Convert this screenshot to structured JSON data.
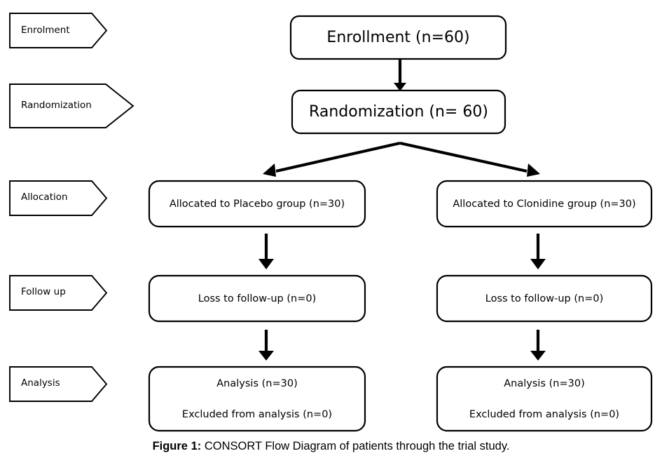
{
  "figure": {
    "caption_label": "Figure 1:",
    "caption_text": " CONSORT Flow Diagram of patients through the trial study."
  },
  "stage_labels": [
    {
      "id": "enrolment",
      "text": "Enrolment"
    },
    {
      "id": "randomization",
      "text": "Randomization"
    },
    {
      "id": "allocation",
      "text": "Allocation"
    },
    {
      "id": "follow-up",
      "text": "Follow up"
    },
    {
      "id": "analysis",
      "text": "Analysis"
    }
  ],
  "nodes": {
    "enrollment": {
      "line1": "Enrollment (n=60)"
    },
    "randomization": {
      "line1": "Randomization (n= 60)"
    },
    "allocation_left": {
      "line1": "Allocated to Placebo group (n=30)"
    },
    "allocation_right": {
      "line1": "Allocated to Clonidine group (n=30)"
    },
    "followup_left": {
      "line1": "Loss to follow-up (n=0)"
    },
    "followup_right": {
      "line1": "Loss to follow-up (n=0)"
    },
    "analysis_left": {
      "line1": "Analysis (n=30)",
      "line2": "Excluded from analysis (n=0)"
    },
    "analysis_right": {
      "line1": "Analysis (n=30)",
      "line2": "Excluded from analysis (n=0)"
    }
  },
  "colors": {
    "stroke": "#000000",
    "fill": "#ffffff",
    "text": "#000000"
  },
  "chart_data": {
    "type": "diagram",
    "title": "CONSORT Flow Diagram of patients through the trial study.",
    "stages": [
      "Enrolment",
      "Randomization",
      "Allocation",
      "Follow up",
      "Analysis"
    ],
    "nodes": [
      {
        "id": "enrollment",
        "stage": "Enrolment",
        "label": "Enrollment (n=60)",
        "n": 60
      },
      {
        "id": "randomization",
        "stage": "Randomization",
        "label": "Randomization (n= 60)",
        "n": 60
      },
      {
        "id": "allocation_left",
        "stage": "Allocation",
        "label": "Allocated to Placebo group (n=30)",
        "n": 30,
        "arm": "Placebo"
      },
      {
        "id": "allocation_right",
        "stage": "Allocation",
        "label": "Allocated to Clonidine group (n=30)",
        "n": 30,
        "arm": "Clonidine"
      },
      {
        "id": "followup_left",
        "stage": "Follow up",
        "label": "Loss to follow-up (n=0)",
        "n": 0,
        "arm": "Placebo"
      },
      {
        "id": "followup_right",
        "stage": "Follow up",
        "label": "Loss to follow-up (n=0)",
        "n": 0,
        "arm": "Clonidine"
      },
      {
        "id": "analysis_left",
        "stage": "Analysis",
        "label": "Analysis (n=30) / Excluded from analysis (n=0)",
        "n": 30,
        "excluded": 0,
        "arm": "Placebo"
      },
      {
        "id": "analysis_right",
        "stage": "Analysis",
        "label": "Analysis (n=30) / Excluded from analysis (n=0)",
        "n": 30,
        "excluded": 0,
        "arm": "Clonidine"
      }
    ],
    "edges": [
      {
        "from": "enrollment",
        "to": "randomization"
      },
      {
        "from": "randomization",
        "to": "allocation_left"
      },
      {
        "from": "randomization",
        "to": "allocation_right"
      },
      {
        "from": "allocation_left",
        "to": "followup_left"
      },
      {
        "from": "allocation_right",
        "to": "followup_right"
      },
      {
        "from": "followup_left",
        "to": "analysis_left"
      },
      {
        "from": "followup_right",
        "to": "analysis_right"
      }
    ]
  }
}
